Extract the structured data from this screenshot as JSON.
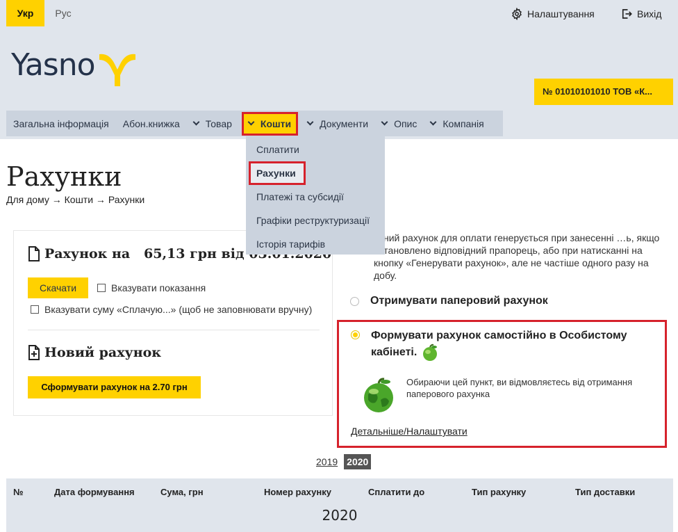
{
  "lang": {
    "ukr": "Укр",
    "rus": "Рус"
  },
  "top_links": {
    "settings": "Налаштування",
    "exit": "Вихід"
  },
  "logo": {
    "text": "Yasno"
  },
  "account": {
    "label": "№ 01010101010 ТОВ «К..."
  },
  "nav": [
    {
      "label": "Загальна інформація",
      "chevron": false
    },
    {
      "label": "Абон.книжка",
      "chevron": false
    },
    {
      "label": "Товар",
      "chevron": true
    },
    {
      "label": "Кошти",
      "chevron": true,
      "active": true
    },
    {
      "label": "Документи",
      "chevron": true
    },
    {
      "label": "Опис",
      "chevron": true
    },
    {
      "label": "Компанія",
      "chevron": true
    }
  ],
  "dropdown": [
    {
      "label": "Сплатити"
    },
    {
      "label": "Рахунки",
      "active": true
    },
    {
      "label": "Платежі та субсидії"
    },
    {
      "label": "Графіки реструктуризації"
    },
    {
      "label": "Історія тарифів"
    }
  ],
  "page": {
    "title": "Рахунки",
    "breadcrumb": "Для дому → Кошти → Рахунки"
  },
  "invoice": {
    "heading": "Рахунок на",
    "amount": "65,13 грн від 03.01.2020",
    "download_label": "Скачати",
    "show_readings": "Вказувати показання",
    "show_sum": "Вказувати суму «Сплачую...» (щоб не заповнювати вручну)"
  },
  "new_invoice": {
    "heading": "Новий рахунок",
    "generate_label": "Сформувати рахунок на 2.70 грн"
  },
  "info": {
    "text": "…ний рахунок для оплати генерується при занесенні …ь, якщо встановлено відповідний прапорець, або при натисканні на кнопку «Генерувати рахунок», але не частіше одного разу на добу."
  },
  "options": {
    "paper": "Отримувати паперовий рахунок",
    "self": "Формувати рахунок самостійно в Особистому кабінеті.",
    "note": "Обираючи цей пункт, ви відмовляєтесь від отримання паперового рахунка",
    "details_link": "Детальніше/Налаштувати"
  },
  "years": {
    "y2019": "2019",
    "y2020": "2020"
  },
  "table": {
    "columns": [
      "№",
      "Дата формування",
      "Сума, грн",
      "Номер рахунку",
      "Сплатити до",
      "Тип рахунку",
      "Тип доставки"
    ],
    "group_year": "2020"
  },
  "colors": {
    "accent": "#ffd100",
    "highlight": "#d6222c",
    "panel": "#e0e5ec",
    "nav": "#cbd3de"
  }
}
